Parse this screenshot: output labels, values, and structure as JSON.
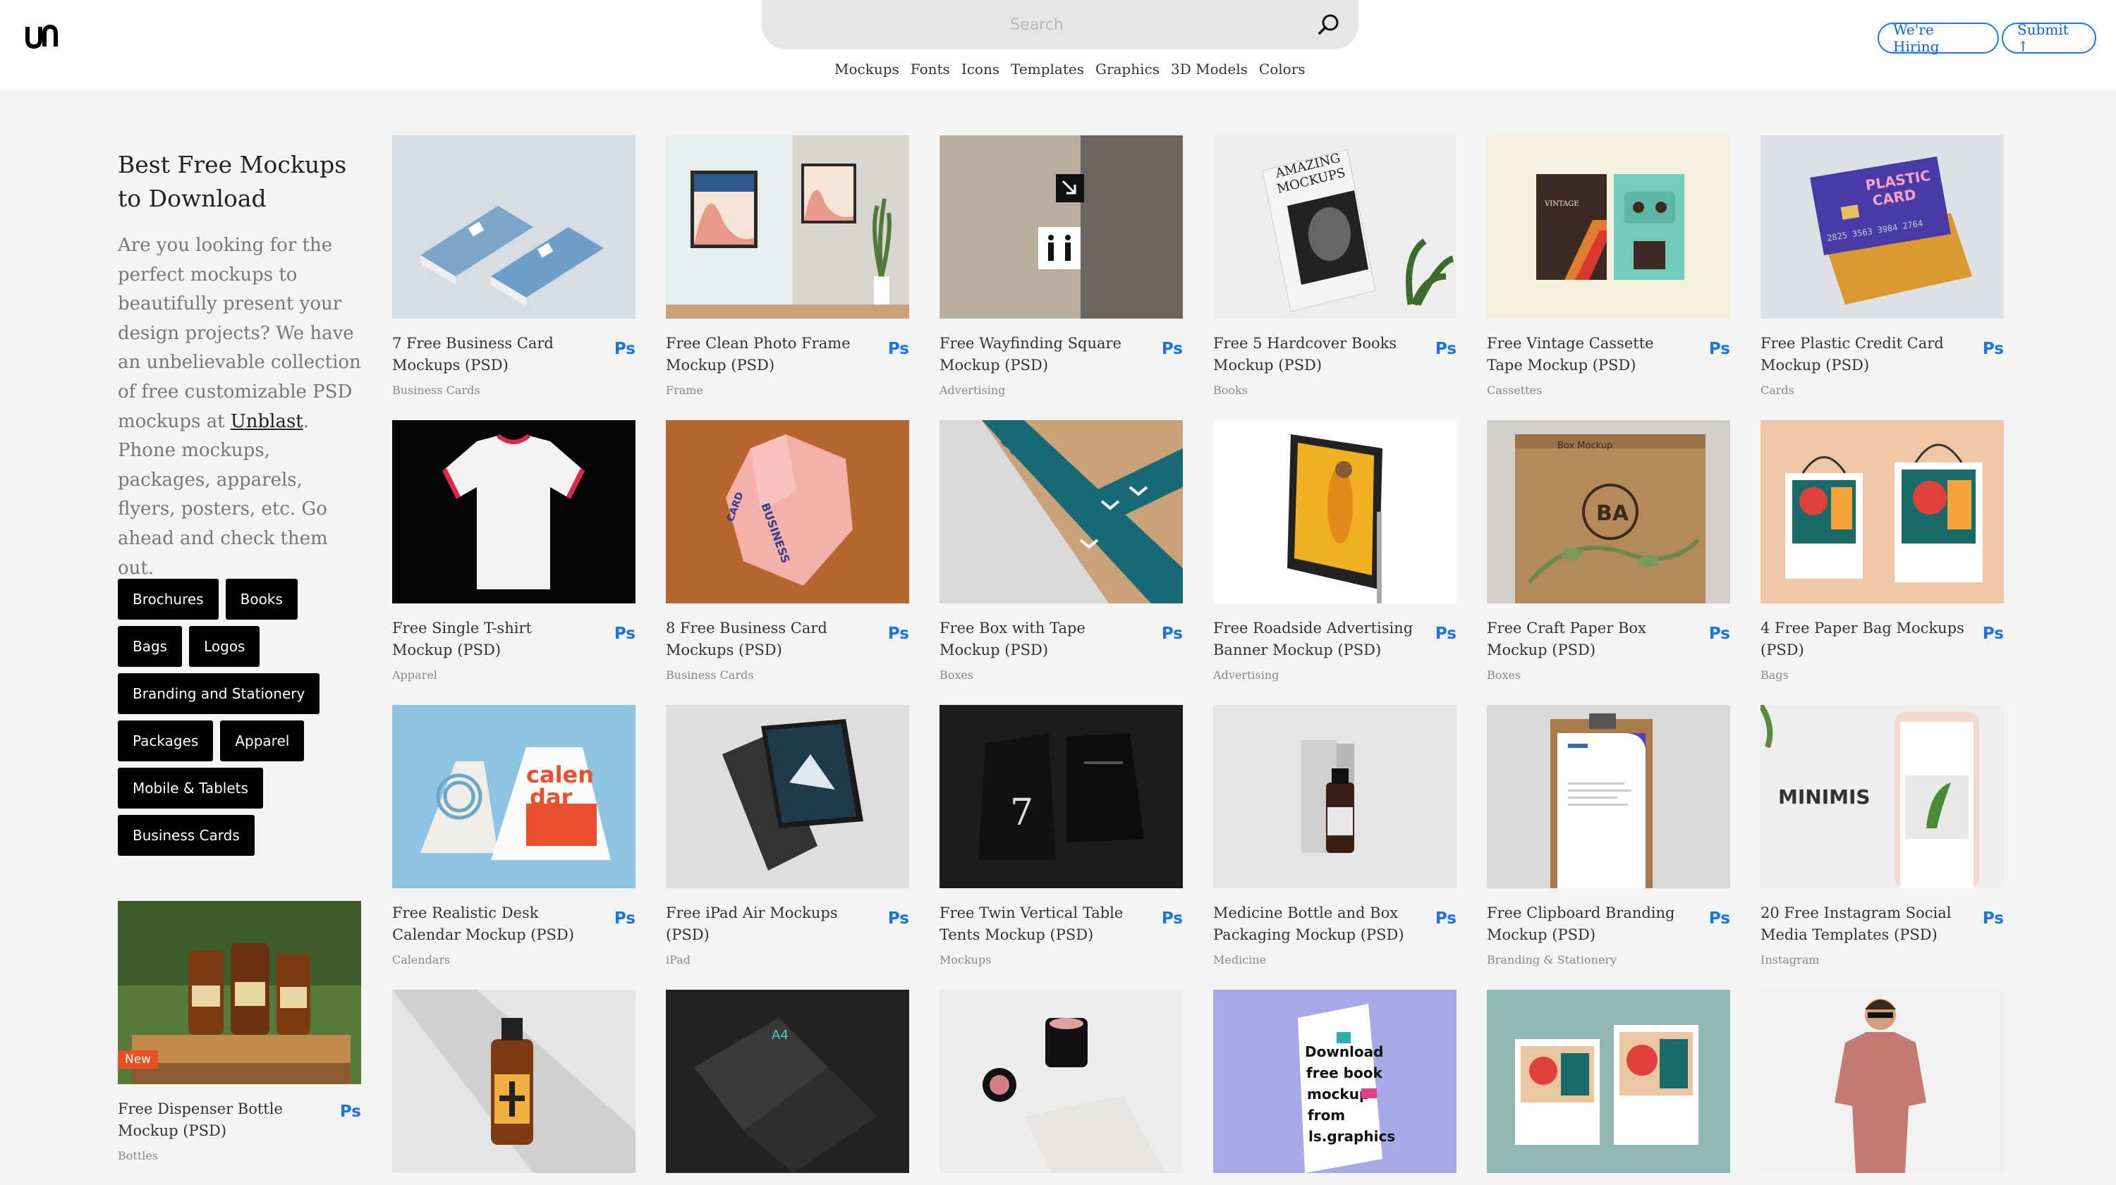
{
  "header": {
    "search_placeholder": "Search",
    "nav": [
      "Mockups",
      "Fonts",
      "Icons",
      "Templates",
      "Graphics",
      "3D Models",
      "Colors"
    ],
    "hiring_label": "We're Hiring",
    "submit_label": "Submit ↑"
  },
  "sidebar": {
    "title": "Best Free Mockups to Download",
    "desc_before": "Are you looking for the perfect mockups to beautifully present your design projects? We have an unbelievable collection of free customizable PSD mockups at ",
    "desc_link": "Unblast",
    "desc_after": ". Phone mockups, packages, apparels, flyers, posters, etc. Go ahead and check them out.",
    "tags": [
      "Brochures",
      "Books",
      "Bags",
      "Logos",
      "Branding and Stationery",
      "Packages",
      "Apparel",
      "Mobile & Tablets",
      "Business Cards"
    ]
  },
  "ps_label": "Ps",
  "new_label": "New",
  "cards": [
    {
      "title": "7 Free Business Card Mockups (PSD)",
      "category": "Business Cards",
      "bg": "#d5dde3"
    },
    {
      "title": "Free Clean Photo Frame Mockup (PSD)",
      "category": "Frame",
      "bg": "#e7ecee"
    },
    {
      "title": "Free Wayfinding Square Mockup (PSD)",
      "category": "Advertising",
      "bg": "#b5aa9a"
    },
    {
      "title": "Free 5 Hardcover Books Mockup (PSD)",
      "category": "Books",
      "bg": "#eeeeee"
    },
    {
      "title": "Free Vintage Cassette Tape Mockup (PSD)",
      "category": "Cassettes",
      "bg": "#f5f0dc"
    },
    {
      "title": "Free Plastic Credit Card Mockup (PSD)",
      "category": "Cards",
      "bg": "#dde1e6"
    },
    {
      "title": "Free Single T-shirt Mockup (PSD)",
      "category": "Apparel",
      "bg": "#050505"
    },
    {
      "title": "8 Free Business Card Mockups (PSD)",
      "category": "Business Cards",
      "bg": "#b5652e"
    },
    {
      "title": "Free Box with Tape Mockup (PSD)",
      "category": "Boxes",
      "bg": "#d9d9d9"
    },
    {
      "title": "Free Roadside Advertising Banner Mockup (PSD)",
      "category": "Advertising",
      "bg": "#ffffff"
    },
    {
      "title": "Free Craft Paper Box Mockup (PSD)",
      "category": "Boxes",
      "bg": "#d3d0cb"
    },
    {
      "title": "4 Free Paper Bag Mockups (PSD)",
      "category": "Bags",
      "bg": "#f1c6a6"
    },
    {
      "title": "Free Realistic Desk Calendar Mockup (PSD)",
      "category": "Calendars",
      "bg": "#8ec5e2"
    },
    {
      "title": "Free iPad Air Mockups (PSD)",
      "category": "iPad",
      "bg": "#dedede"
    },
    {
      "title": "Free Twin Vertical Table Tents Mockup (PSD)",
      "category": "Mockups",
      "bg": "#1c1c1c"
    },
    {
      "title": "Medicine Bottle and Box Packaging Mockup (PSD)",
      "category": "Medicine",
      "bg": "#e4e4e4"
    },
    {
      "title": "Free Clipboard Branding Mockup (PSD)",
      "category": "Branding & Stationery",
      "bg": "#d9d9d9"
    },
    {
      "title": "20 Free Instagram Social Media Templates (PSD)",
      "category": "Instagram",
      "bg": "#eeeeee"
    },
    {
      "title": "",
      "category": "",
      "bg": "#e5e5e5"
    },
    {
      "title": "",
      "category": "",
      "bg": "#222222"
    },
    {
      "title": "",
      "category": "",
      "bg": "#ececec"
    },
    {
      "title": "",
      "category": "",
      "bg": "#a6a9e6"
    },
    {
      "title": "",
      "category": "",
      "bg": "#8fb8b3"
    },
    {
      "title": "",
      "category": "",
      "bg": "#f1f1f1"
    }
  ],
  "side_card": {
    "title": "Free Dispenser Bottle Mockup (PSD)",
    "category": "Bottles",
    "bg": "#3d5a2a"
  }
}
